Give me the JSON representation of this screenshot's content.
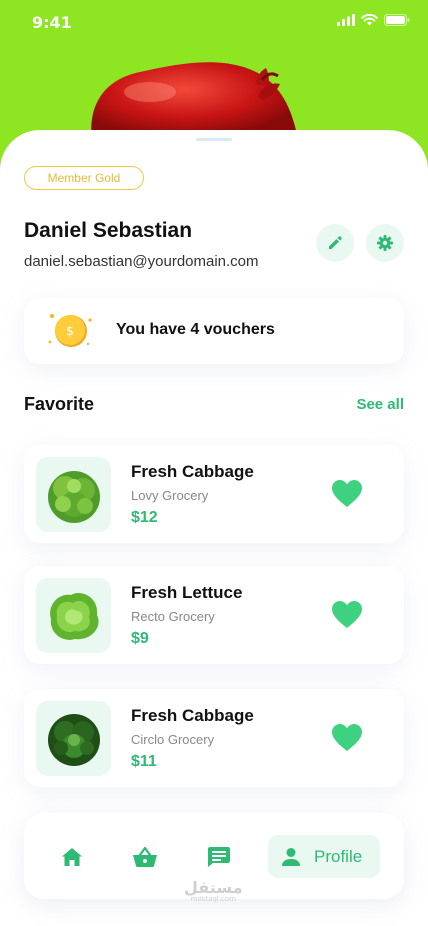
{
  "status_bar": {
    "time": "9:41"
  },
  "profile": {
    "badge": "Member Gold",
    "name": "Daniel Sebastian",
    "email": "daniel.sebastian@yourdomain.com"
  },
  "voucher": {
    "text": "You have 4 vouchers",
    "coin_symbol": "$"
  },
  "favorites": {
    "title": "Favorite",
    "see_all": "See all",
    "items": [
      {
        "name": "Fresh Cabbage",
        "store": "Lovy Grocery",
        "price": "$12"
      },
      {
        "name": "Fresh Lettuce",
        "store": "Recto Grocery",
        "price": "$9"
      },
      {
        "name": "Fresh Cabbage",
        "store": "Circlo Grocery",
        "price": "$11"
      }
    ]
  },
  "nav": {
    "profile_label": "Profile"
  },
  "watermark": {
    "text": "مستقل",
    "sub": "mostaql.com"
  },
  "colors": {
    "accent": "#2fba73",
    "hero": "#8ee521",
    "badge": "#f2c744"
  }
}
